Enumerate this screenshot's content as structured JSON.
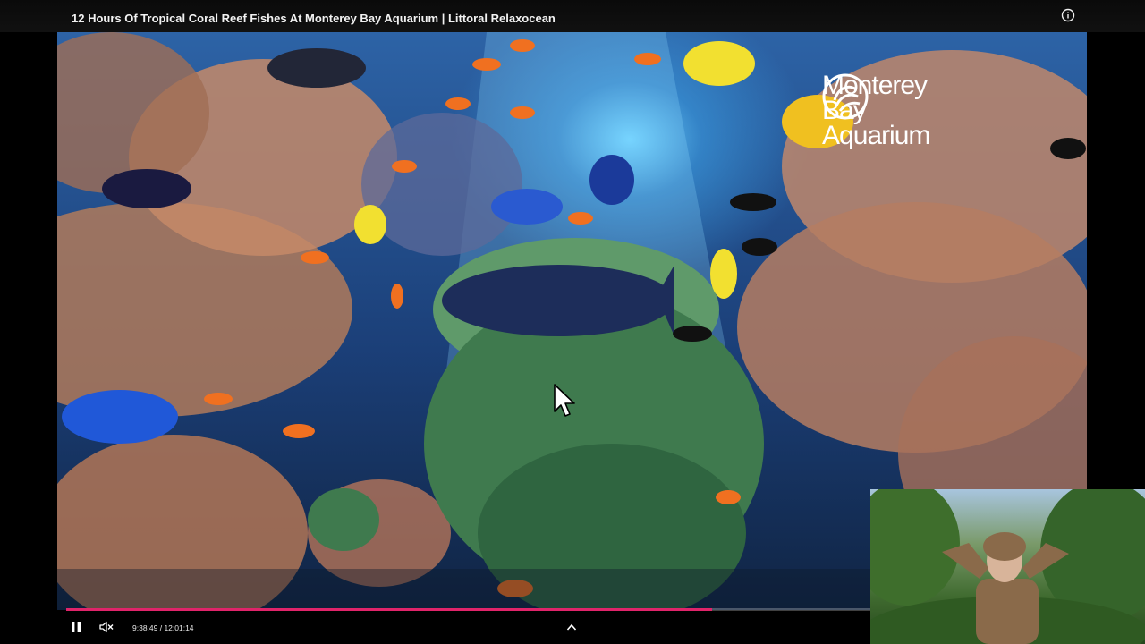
{
  "video": {
    "title": "12 Hours Of Tropical Coral Reef Fishes At Monterey Bay Aquarium | Littoral Relaxocean",
    "watermark": "Monterey Bay Aquarium"
  },
  "controls": {
    "current_time": "9:38:49",
    "duration": "12:01:14",
    "time_display": "9:38:49 / 12:01:14",
    "progress": 0.8034,
    "state": "playing",
    "muted": true
  },
  "icons": {
    "info": "info-icon",
    "pause": "pause-icon",
    "mute": "volume-muted-icon",
    "expand": "chevron-up-icon",
    "cursor": "mouse-cursor-icon"
  },
  "colors": {
    "progress": "#e0246a",
    "background": "#000000",
    "text": "#f2f2f2"
  }
}
